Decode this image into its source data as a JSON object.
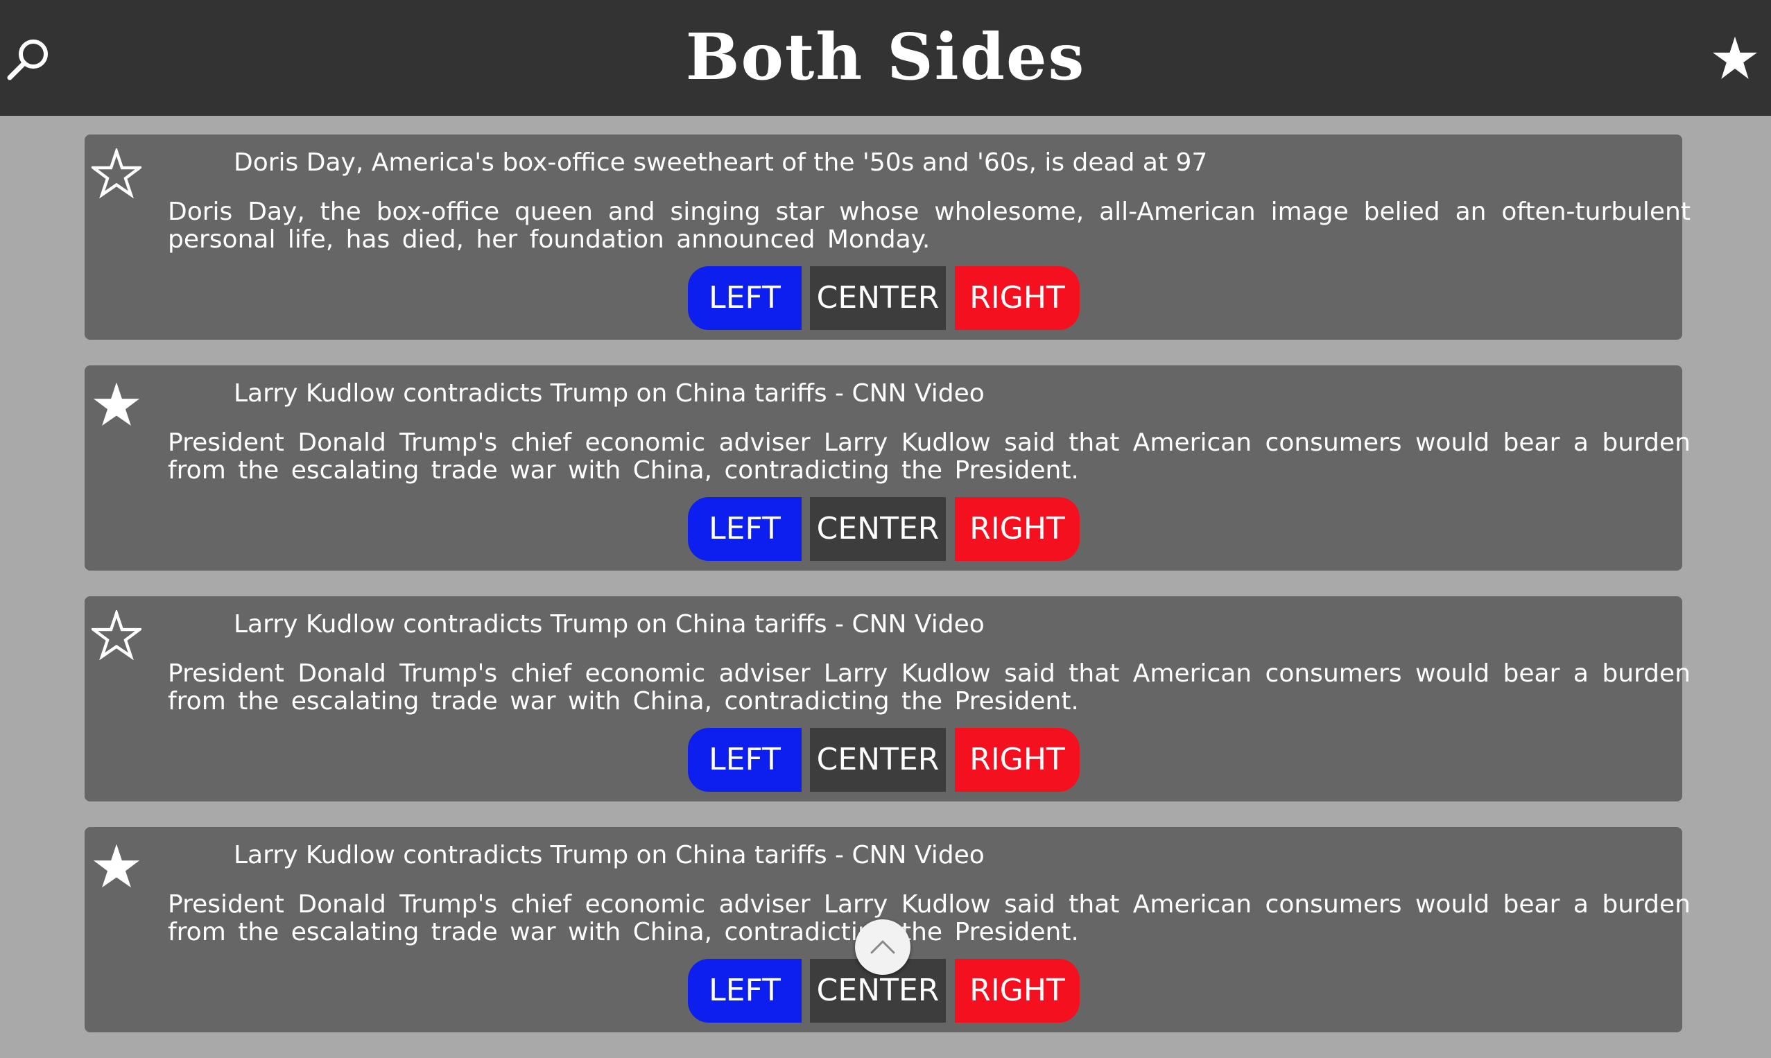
{
  "header": {
    "title": "Both Sides",
    "search_icon": "search-icon",
    "favorites_icon": "star-filled-icon"
  },
  "colors": {
    "header_bg": "#333333",
    "page_bg": "#a9a9a9",
    "card_bg": "#666666",
    "left_button": "#0d1fef",
    "center_button": "#3d3d3d",
    "right_button": "#f5101f"
  },
  "buttons": {
    "left": "LEFT",
    "center": "CENTER",
    "right": "RIGHT"
  },
  "articles": [
    {
      "starred": false,
      "title": "Doris Day, America's box-office sweetheart of the '50s and '60s, is dead at 97",
      "description": "Doris Day, the box-office queen and singing star whose wholesome, all-American image belied an often-turbulent personal life, has died, her foundation announced Monday."
    },
    {
      "starred": true,
      "title": "Larry Kudlow contradicts Trump on China tariffs - CNN Video",
      "description": "President Donald Trump's chief economic adviser Larry Kudlow said that American consumers would bear a burden from the escalating trade war with China, contradicting the President."
    },
    {
      "starred": false,
      "title": "Larry Kudlow contradicts Trump on China tariffs - CNN Video",
      "description": "President Donald Trump's chief economic adviser Larry Kudlow said that American consumers would bear a burden from the escalating trade war with China, contradicting the President."
    },
    {
      "starred": true,
      "title": "Larry Kudlow contradicts Trump on China tariffs - CNN Video",
      "description": "President Donald Trump's chief economic adviser Larry Kudlow said that American consumers would bear a burden from the escalating trade war with China, contradicting the President."
    }
  ],
  "scroll_top_icon": "chevron-up-icon"
}
